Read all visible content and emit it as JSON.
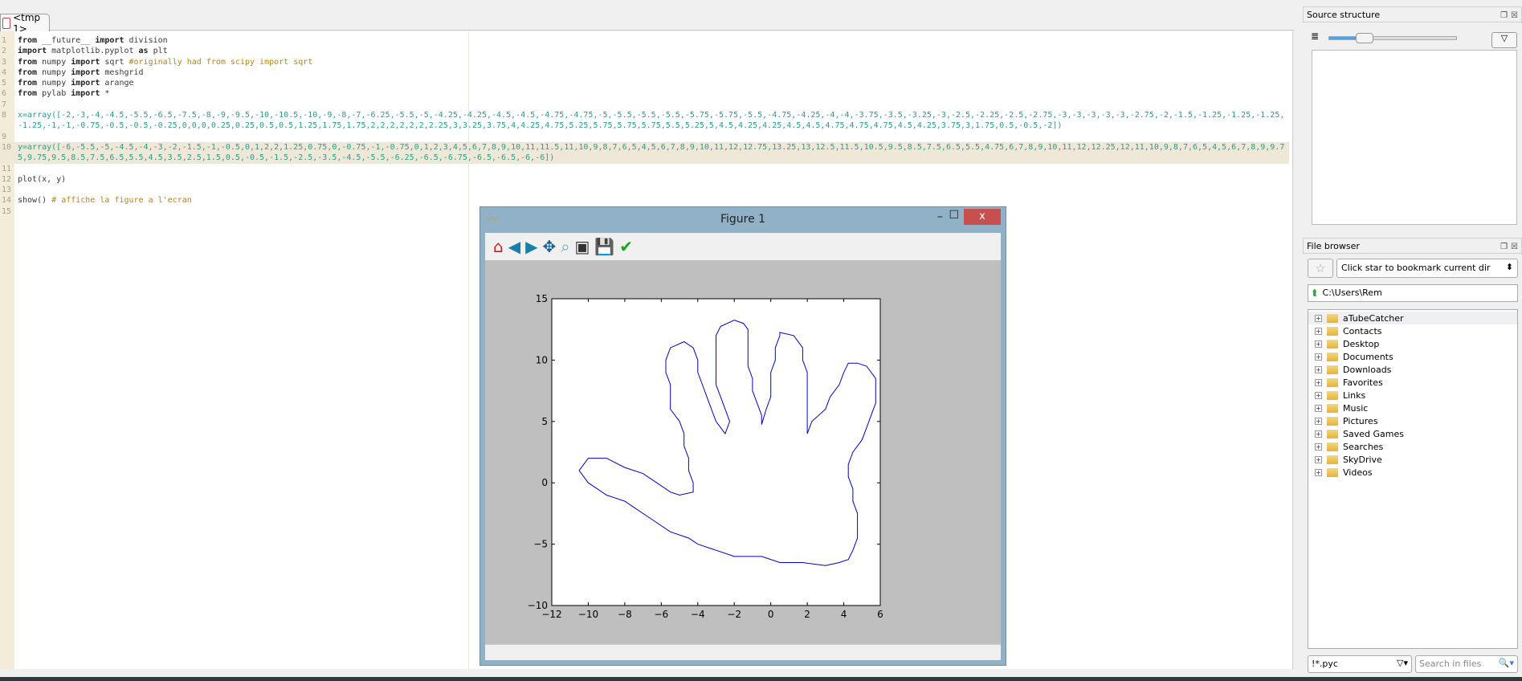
{
  "editor": {
    "tab_label": "<tmp 1>",
    "lines": [
      "from __future__ import division",
      "import matplotlib.pyplot as plt",
      "from numpy import sqrt #originally had from scipy import sqrt",
      "from numpy import meshgrid",
      "from numpy import arange",
      "from pylab import *",
      "",
      "x=array([-2,-3,-4,-4.5,-5.5,-6.5,-7.5,-8,-9,-9.5,-10,-10.5,-10,-9,-8,-7,-6.25,-5.5,-5,-4.25,-4.25,-4.5,-4.5,-4.75,-4.75,-5,-5.5,-5.5,-5.5,-5.75,-5.75,-5.5,-4.75,-4.25,-4,-4,-3.75,-3.5,-3.25,-3,-2.5,-2.25,-2.5,-2.75,-3,-3,-3,-3,-3,-2.75,-2,-1.5,-1.25,-1.25,-1.25,-1.25,-1,-1,-0.75,-0.5,-0.5,-0.25,0,0,0,0.25,0.25,0.5,0.5,1.25,1.75,1.75,2,2,2,2,2,2,2.25,3,3.25,3.75,4,4.25,4.75,5.25,5.75,5.75,5.75,5.5,5.25,5,4.5,4.25,4.25,4.5,4.5,4.75,4.75,4.75,4.5,4.25,3.75,3,1.75,0.5,-0.5,-2])",
      "",
      "y=array([-6,-5.5,-5,-4.5,-4,-3,-2,-1.5,-1,-0.5,0,1,2,2,1.25,0.75,0,-0.75,-1,-0.75,0,1,2,3,4,5,6,7,8,9,10,11,11.5,11,10,9,8,7,6,5,4,5,6,7,8,9,10,11,12,12.75,13.25,13,12.5,11.5,10.5,9.5,8.5,7.5,6.5,5.5,4.75,6,7,8,9,10,11,12,12.25,12,11,10,9,8,7,6,5,4,5,6,7,8,9,9.75,9.75,9.5,8.5,7.5,6.5,5.5,4.5,3.5,2.5,1.5,0.5,-0.5,-1.5,-2.5,-3.5,-4.5,-5.5,-6.25,-6.5,-6.75,-6.5,-6.5,-6,-6])",
      "",
      "plot(x, y)",
      "",
      "show() # affiche la figure a l'ecran",
      ""
    ],
    "highlighted_line": 10
  },
  "source_structure": {
    "title": "Source structure"
  },
  "file_browser": {
    "title": "File browser",
    "bookmark_placeholder": "Click star to bookmark current dir",
    "path": "C:\\Users\\Rem",
    "items": [
      "aTubeCatcher",
      "Contacts",
      "Desktop",
      "Documents",
      "Downloads",
      "Favorites",
      "Links",
      "Music",
      "Pictures",
      "Saved Games",
      "Searches",
      "SkyDrive",
      "Videos"
    ],
    "filter": "!*.pyc",
    "search_placeholder": "Search in files"
  },
  "figure": {
    "title": "Figure 1",
    "toolbar": [
      "home-icon",
      "back-icon",
      "forward-icon",
      "pan-icon",
      "zoom-icon",
      "subplots-icon",
      "save-icon",
      "edit-check-icon"
    ],
    "close_label": "x",
    "line_color": "#0000cc"
  },
  "chart_data": {
    "type": "line",
    "xlim": [
      -12,
      6
    ],
    "ylim": [
      -10,
      15
    ],
    "xticks": [
      "−12",
      "−10",
      "−8",
      "−6",
      "−4",
      "−2",
      "0",
      "2",
      "4",
      "6"
    ],
    "yticks": [
      "−10",
      "−5",
      "0",
      "5",
      "10",
      "15"
    ],
    "grid": false,
    "x": [
      -2,
      -3,
      -4,
      -4.5,
      -5.5,
      -6.5,
      -7.5,
      -8,
      -9,
      -9.5,
      -10,
      -10.5,
      -10,
      -9,
      -8,
      -7,
      -6.25,
      -5.5,
      -5,
      -4.25,
      -4.25,
      -4.5,
      -4.5,
      -4.75,
      -4.75,
      -5,
      -5.5,
      -5.5,
      -5.5,
      -5.75,
      -5.75,
      -5.5,
      -4.75,
      -4.25,
      -4,
      -4,
      -3.75,
      -3.5,
      -3.25,
      -3,
      -2.5,
      -2.25,
      -2.5,
      -2.75,
      -3,
      -3,
      -3,
      -3,
      -3,
      -2.75,
      -2,
      -1.5,
      -1.25,
      -1.25,
      -1.25,
      -1.25,
      -1,
      -1,
      -0.75,
      -0.5,
      -0.5,
      -0.25,
      0,
      0,
      0,
      0.25,
      0.25,
      0.5,
      0.5,
      1.25,
      1.75,
      1.75,
      2,
      2,
      2,
      2,
      2,
      2,
      2.25,
      3,
      3.25,
      3.75,
      4,
      4.25,
      4.75,
      5.25,
      5.75,
      5.75,
      5.75,
      5.5,
      5.25,
      5,
      4.5,
      4.25,
      4.25,
      4.5,
      4.5,
      4.75,
      4.75,
      4.75,
      4.5,
      4.25,
      3.75,
      3,
      1.75,
      0.5,
      -0.5,
      -2
    ],
    "y": [
      -6,
      -5.5,
      -5,
      -4.5,
      -4,
      -3,
      -2,
      -1.5,
      -1,
      -0.5,
      0,
      1,
      2,
      2,
      1.25,
      0.75,
      0,
      -0.75,
      -1,
      -0.75,
      0,
      1,
      2,
      3,
      4,
      5,
      6,
      7,
      8,
      9,
      10,
      11,
      11.5,
      11,
      10,
      9,
      8,
      7,
      6,
      5,
      4,
      5,
      6,
      7,
      8,
      9,
      10,
      11,
      12,
      12.75,
      13.25,
      13,
      12.5,
      11.5,
      10.5,
      9.5,
      8.5,
      7.5,
      6.5,
      5.5,
      4.75,
      6,
      7,
      8,
      9,
      10,
      11,
      12,
      12.25,
      12,
      11,
      10,
      9,
      8,
      7,
      6,
      5,
      4,
      5,
      6,
      7,
      8,
      9,
      9.75,
      9.75,
      9.5,
      8.5,
      7.5,
      6.5,
      5.5,
      4.5,
      3.5,
      2.5,
      1.5,
      0.5,
      -0.5,
      -1.5,
      -2.5,
      -3.5,
      -4.5,
      -5.5,
      -6.25,
      -6.5,
      -6.75,
      -6.5,
      -6.5,
      -6,
      -6
    ]
  }
}
